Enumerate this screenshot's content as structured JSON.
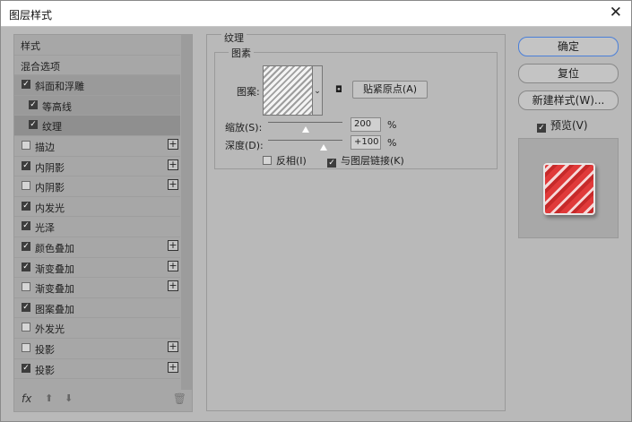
{
  "window": {
    "title": "图层样式",
    "close": "✕"
  },
  "left": {
    "items": [
      {
        "label": "样式",
        "checkbox": false,
        "checked": false,
        "plus": false
      },
      {
        "label": "混合选项",
        "checkbox": false,
        "checked": false,
        "plus": false
      },
      {
        "label": "斜面和浮雕",
        "checkbox": true,
        "checked": true,
        "plus": false
      },
      {
        "label": "等高线",
        "checkbox": true,
        "checked": true,
        "plus": false,
        "sub": true
      },
      {
        "label": "纹理",
        "checkbox": true,
        "checked": true,
        "plus": false,
        "sub": true
      },
      {
        "label": "描边",
        "checkbox": true,
        "checked": false,
        "plus": true
      },
      {
        "label": "内阴影",
        "checkbox": true,
        "checked": true,
        "plus": true
      },
      {
        "label": "内阴影",
        "checkbox": true,
        "checked": false,
        "plus": true
      },
      {
        "label": "内发光",
        "checkbox": true,
        "checked": true,
        "plus": false
      },
      {
        "label": "光泽",
        "checkbox": true,
        "checked": true,
        "plus": false
      },
      {
        "label": "颜色叠加",
        "checkbox": true,
        "checked": true,
        "plus": true
      },
      {
        "label": "渐变叠加",
        "checkbox": true,
        "checked": true,
        "plus": true
      },
      {
        "label": "渐变叠加",
        "checkbox": true,
        "checked": false,
        "plus": true
      },
      {
        "label": "图案叠加",
        "checkbox": true,
        "checked": true,
        "plus": false
      },
      {
        "label": "外发光",
        "checkbox": true,
        "checked": false,
        "plus": false
      },
      {
        "label": "投影",
        "checkbox": true,
        "checked": false,
        "plus": true
      },
      {
        "label": "投影",
        "checkbox": true,
        "checked": true,
        "plus": true
      }
    ],
    "footer": {
      "fx": "fx",
      "up": "⬆",
      "down": "⬇",
      "trash": "🗑"
    }
  },
  "center": {
    "section": "纹理",
    "group": "图素",
    "pattern_label": "图案:",
    "snap_label": "贴紧原点(A)",
    "scale_label": "缩放(S):",
    "scale_value": "200",
    "scale_level": 0.5,
    "depth_label": "深度(D):",
    "depth_value": "+100",
    "depth_level": 0.75,
    "pct": "%",
    "invert_label": "反相(I)",
    "invert_checked": false,
    "link_label": "与图层链接(K)",
    "link_checked": true
  },
  "right": {
    "ok": "确定",
    "reset": "复位",
    "new_style": "新建样式(W)...",
    "preview_label": "预览(V)",
    "preview_checked": true
  },
  "colors": {
    "accent": "#4a7fd9",
    "panel": "#b9b9b9",
    "selected": "#8f8f8f",
    "preview_red": "#e03a3a"
  }
}
